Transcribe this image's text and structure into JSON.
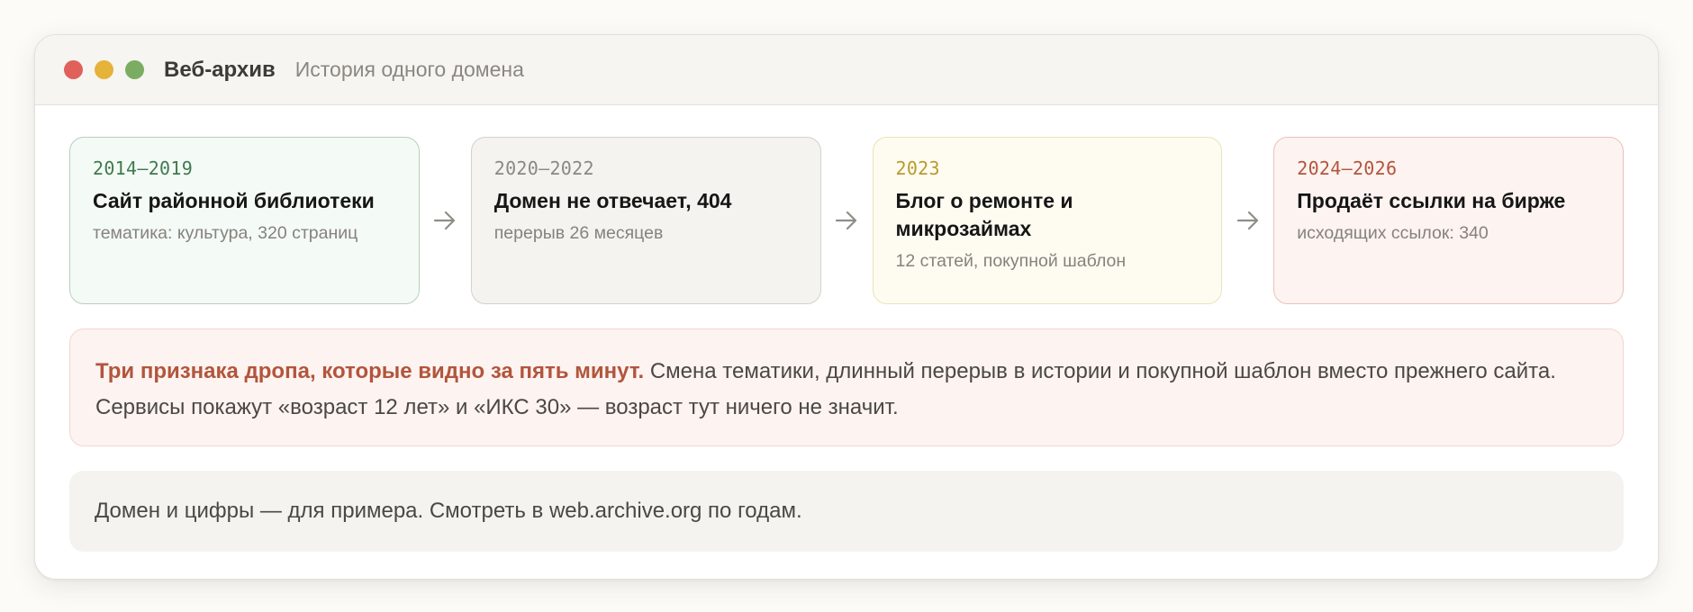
{
  "window": {
    "title": "Веб-архив",
    "subtitle": "История одного домена",
    "controls": [
      {
        "name": "close",
        "color": "#e0605a"
      },
      {
        "name": "minimize",
        "color": "#e5b23a"
      },
      {
        "name": "maximize",
        "color": "#7aad62"
      }
    ]
  },
  "timeline": [
    {
      "years": "2014–2019",
      "title": "Сайт районной библиотеки",
      "desc": "тематика: культура, 320 страниц",
      "bg": "#f4faf5",
      "border": "#b9cfbe",
      "years_color": "#3f7a4f"
    },
    {
      "years": "2020–2022",
      "title": "Домен не отвечает, 404",
      "desc": "перерыв 26 месяцев",
      "bg": "#f4f3ef",
      "border": "#d3d1ca",
      "years_color": "#8a8881"
    },
    {
      "years": "2023",
      "title": "Блог о ремонте и микрозаймах",
      "desc": "12 статей, покупной шаблон",
      "bg": "#fefcf1",
      "border": "#ece2b8",
      "years_color": "#b99a2e"
    },
    {
      "years": "2024–2026",
      "title": "Продаёт ссылки на бирже",
      "desc": "исходящих ссылок: 340",
      "bg": "#fdf3f1",
      "border": "#e8c2ba",
      "years_color": "#b2553c"
    }
  ],
  "arrow_icon": "arrow-right-icon",
  "notice": {
    "lead": "Три признака дропа, которые видно за пять минут.",
    "body": "Смена тематики, длинный перерыв в истории и покупной шаблон вместо прежнего сайта. Сервисы покажут «возраст 12 лет» и «ИКС 30» — возраст тут ничего не значит."
  },
  "footer_note": "Домен и цифры — для примера. Смотреть в web.archive.org по годам."
}
